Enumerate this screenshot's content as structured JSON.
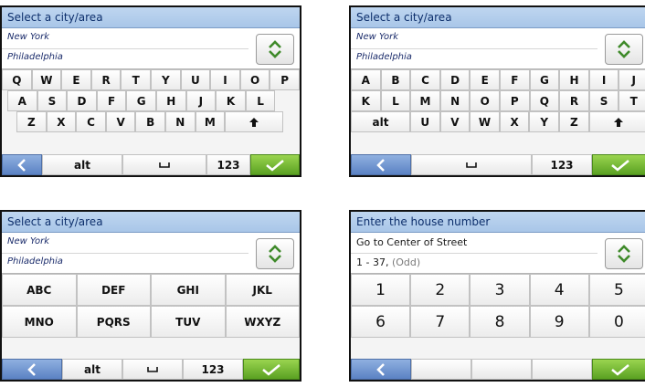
{
  "panels": [
    {
      "title": "Select a city/area",
      "results": [
        "New York",
        "Philadelphia"
      ],
      "rows": [
        [
          "Q",
          "W",
          "E",
          "R",
          "T",
          "Y",
          "U",
          "I",
          "O",
          "P"
        ],
        [
          "A",
          "S",
          "D",
          "F",
          "G",
          "H",
          "J",
          "K",
          "L"
        ],
        [
          "Z",
          "X",
          "C",
          "V",
          "B",
          "N",
          "M",
          "shift-arrow"
        ]
      ],
      "bottom": {
        "alt": "alt",
        "num": "123"
      }
    },
    {
      "title": "Select a city/area",
      "results": [
        "New York",
        "Philadelphia"
      ],
      "rows": [
        [
          "A",
          "B",
          "C",
          "D",
          "E",
          "F",
          "G",
          "H",
          "I",
          "J"
        ],
        [
          "K",
          "L",
          "M",
          "N",
          "O",
          "P",
          "Q",
          "R",
          "S",
          "T"
        ],
        [
          "alt",
          "U",
          "V",
          "W",
          "X",
          "Y",
          "Z",
          "shift-arrow"
        ]
      ],
      "bottom": {
        "num": "123"
      }
    },
    {
      "title": "Select a city/area",
      "results": [
        "New York",
        "Philadelphia"
      ],
      "groups": [
        [
          "ABC",
          "DEF",
          "GHI",
          "JKL"
        ],
        [
          "MNO",
          "PQRS",
          "TUV",
          "WXYZ"
        ]
      ],
      "bottom": {
        "alt": "alt",
        "num": "123"
      }
    },
    {
      "title": "Enter the house number",
      "results_main": "Go to Center of Street",
      "range": "1 - 37,",
      "range_note": "(Odd)",
      "digits": [
        [
          "1",
          "2",
          "3",
          "4",
          "5"
        ],
        [
          "6",
          "7",
          "8",
          "9",
          "0"
        ]
      ]
    }
  ],
  "colors": {
    "header": "#a9c6e8",
    "back_button": "#5b82c4",
    "ok_button": "#5aa122"
  },
  "icons": {
    "scroll": "up-down-chevron-icon",
    "back": "chevron-left-icon",
    "space": "space-bar-icon",
    "ok": "checkmark-icon",
    "shift": "shift-arrow-icon"
  }
}
